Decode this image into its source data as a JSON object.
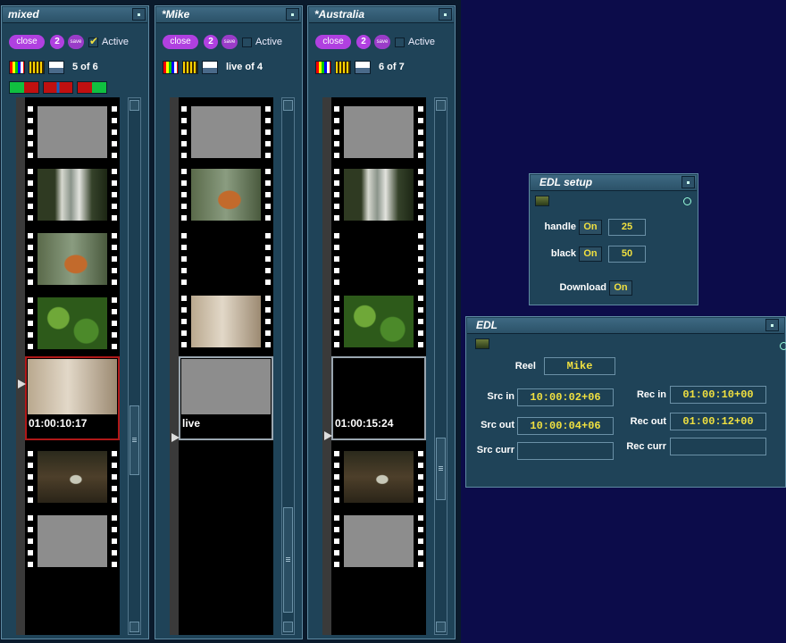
{
  "panels": [
    {
      "title": "mixed",
      "close": "close",
      "num": "2",
      "save": "save",
      "active_label": "Active",
      "active_checked": true,
      "counter": "5 of 6",
      "current_timecode": "01:00:10:17"
    },
    {
      "title": "*Mike",
      "close": "close",
      "num": "2",
      "save": "save",
      "active_label": "Active",
      "active_checked": false,
      "counter": "live of 4",
      "current_timecode": "live"
    },
    {
      "title": "*Australia",
      "close": "close",
      "num": "2",
      "save": "save",
      "active_label": "Active",
      "active_checked": false,
      "counter": "6 of 7",
      "current_timecode": "01:00:15:24"
    }
  ],
  "edl_setup": {
    "title": "EDL setup",
    "handle_label": "handle",
    "handle_toggle": "On",
    "handle_value": "25",
    "black_label": "black",
    "black_toggle": "On",
    "black_value": "50",
    "download_label": "Download",
    "download_toggle": "On"
  },
  "edl": {
    "title": "EDL",
    "reel_label": "Reel",
    "reel_value": "Mike",
    "src_in_label": "Src in",
    "src_in_value": "10:00:02+06",
    "src_out_label": "Src out",
    "src_out_value": "10:00:04+06",
    "src_curr_label": "Src curr",
    "src_curr_value": "",
    "rec_in_label": "Rec in",
    "rec_in_value": "01:00:10+00",
    "rec_out_label": "Rec out",
    "rec_out_value": "01:00:12+00",
    "rec_curr_label": "Rec curr",
    "rec_curr_value": ""
  },
  "colors": {
    "desktop": "#0c0c4a",
    "panel": "#1f4358",
    "accent_pill": "#b040e0",
    "value_text": "#f0e040",
    "current_frame_border": "#b01818"
  }
}
